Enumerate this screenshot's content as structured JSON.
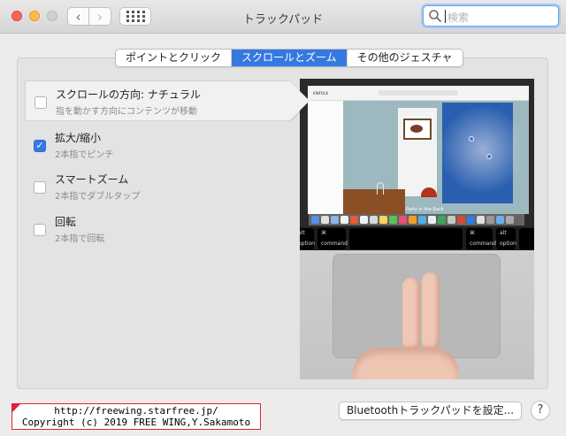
{
  "window": {
    "title": "トラックパッド"
  },
  "toolbar": {
    "back_glyph": "‹",
    "forward_glyph": "›",
    "search_placeholder": "検索"
  },
  "tabs": [
    {
      "label": "ポイントとクリック",
      "active": false
    },
    {
      "label": "スクロールとズーム",
      "active": true
    },
    {
      "label": "その他のジェスチャ",
      "active": false
    }
  ],
  "options": [
    {
      "title": "スクロールの方向: ナチュラル",
      "subtitle": "指を動かす方向にコンテンツが移動",
      "checked": false,
      "selected": true
    },
    {
      "title": "拡大/縮小",
      "subtitle": "2本指でピンチ",
      "checked": true,
      "selected": false
    },
    {
      "title": "スマートズーム",
      "subtitle": "2本指でダブルタップ",
      "checked": false,
      "selected": false
    },
    {
      "title": "回転",
      "subtitle": "2本指で回転",
      "checked": false,
      "selected": false
    }
  ],
  "preview": {
    "site_logo": "KINFOLK",
    "caption": "Party in the Back",
    "keys": [
      {
        "sym": "⌘",
        "label": "command"
      },
      {
        "sym": "⌘",
        "label": "command"
      },
      {
        "sym": "alt",
        "label": "option"
      },
      {
        "sym": "alt",
        "label": "option"
      }
    ]
  },
  "footer": {
    "copyright_line1": "http://freewing.starfree.jp/",
    "copyright_line2": "Copyright (c) 2019 FREE WING,Y.Sakamoto",
    "bluetooth_button": "Bluetoothトラックパッドを設定...",
    "help_button": "?"
  },
  "colors": {
    "accent": "#3479e0",
    "close": "#fc605c",
    "minimize": "#fdbc40",
    "stamp_border": "#e0203a"
  },
  "icons": {
    "search": "magnifier-icon",
    "grid": "show-all-grid-icon",
    "check": "checkmark-icon"
  }
}
